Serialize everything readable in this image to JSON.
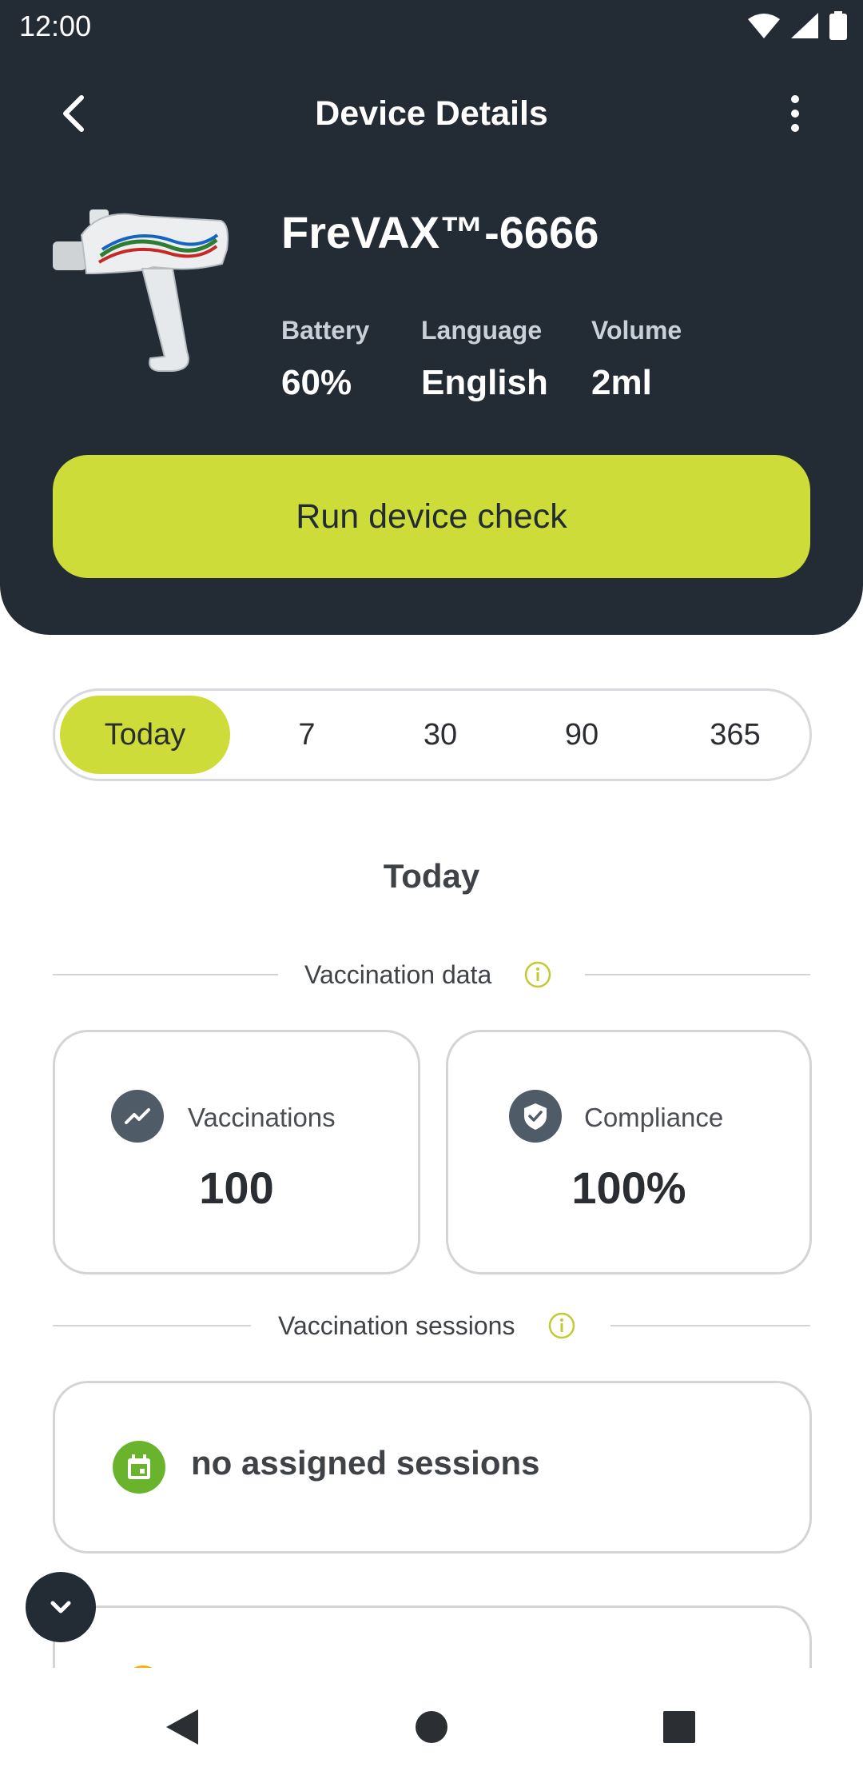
{
  "status_bar": {
    "time": "12:00",
    "icons": [
      "wifi-icon",
      "signal-icon",
      "battery-icon"
    ]
  },
  "topbar": {
    "title": "Device Details",
    "back_icon": "chevron-left-icon",
    "more_icon": "more-vert-icon"
  },
  "device": {
    "name": "FreVAX™-6666",
    "stats": [
      {
        "label": "Battery",
        "value": "60%"
      },
      {
        "label": "Language",
        "value": "English"
      },
      {
        "label": "Volume",
        "value": "2ml"
      }
    ],
    "run_check_label": "Run device check"
  },
  "period_selector": {
    "options": [
      "Today",
      "7",
      "30",
      "90",
      "365"
    ],
    "selected": "Today"
  },
  "section_title": "Today",
  "vaccination_data": {
    "label": "Vaccination data",
    "cards": [
      {
        "label": "Vaccinations",
        "value": "100",
        "icon": "trending-up-icon"
      },
      {
        "label": "Compliance",
        "value": "100%",
        "icon": "shield-check-icon"
      }
    ]
  },
  "vaccination_sessions": {
    "label": "Vaccination sessions",
    "empty_text": "no assigned sessions",
    "icon": "calendar-icon"
  },
  "colors": {
    "header_bg": "#232c35",
    "accent": "#cddc39",
    "session_icon": "#6ab42d"
  }
}
